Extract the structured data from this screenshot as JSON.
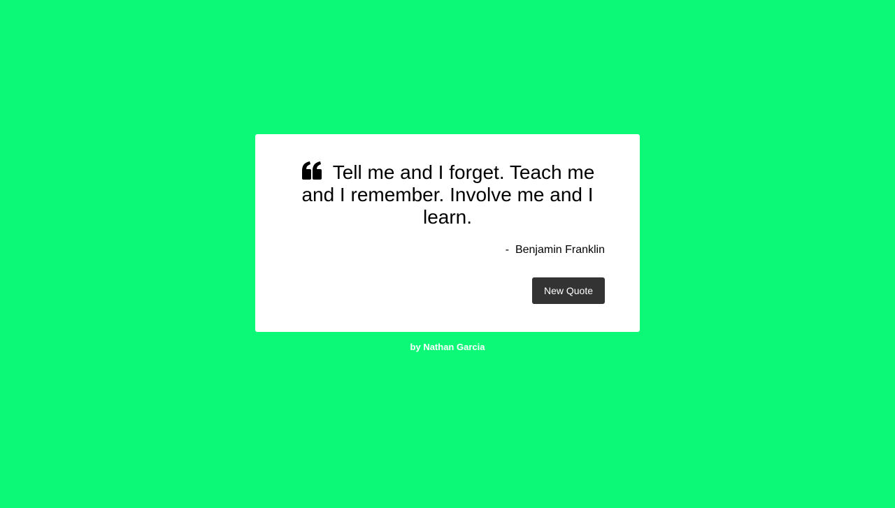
{
  "theme": {
    "background_color": "#0bf977",
    "card_color": "#ffffff",
    "button_color": "#333333"
  },
  "quote": {
    "icon": "quote-left-icon",
    "text": "Tell me and I forget. Teach me and I remember. Involve me and I learn.",
    "author": "-  Benjamin Franklin"
  },
  "actions": {
    "new_quote_label": "New Quote"
  },
  "footer": {
    "credit": "by Nathan Garcia"
  }
}
